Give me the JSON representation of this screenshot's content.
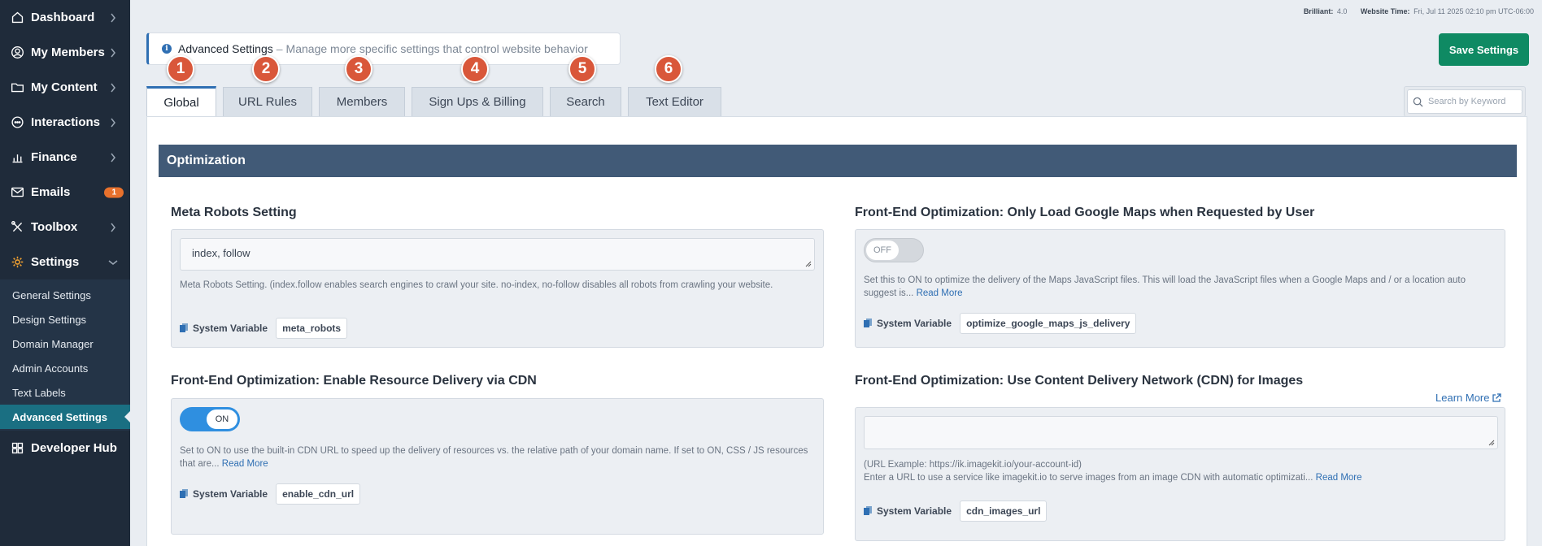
{
  "sidebar": {
    "items": [
      {
        "label": "Dashboard",
        "icon": "home-icon"
      },
      {
        "label": "My Members",
        "icon": "user-circle-icon"
      },
      {
        "label": "My Content",
        "icon": "folder-icon"
      },
      {
        "label": "Interactions",
        "icon": "chat-icon"
      },
      {
        "label": "Finance",
        "icon": "bar-chart-icon"
      },
      {
        "label": "Emails",
        "icon": "mail-icon",
        "badge": "1"
      },
      {
        "label": "Toolbox",
        "icon": "tools-icon"
      },
      {
        "label": "Settings",
        "icon": "gear-icon"
      }
    ],
    "sub_items": [
      "General Settings",
      "Design Settings",
      "Domain Manager",
      "Admin Accounts",
      "Text Labels",
      "Advanced Settings"
    ],
    "developer_hub": "Developer Hub",
    "colors": {
      "background": "#1f2b3a",
      "active": "#1a6f82",
      "badge": "#e8712c"
    }
  },
  "top_info": {
    "brilliant_label": "Brilliant:",
    "brilliant_value": "4.0",
    "time_label": "Website Time:",
    "time_value": "Fri, Jul 11 2025 02:10 pm UTC-06:00"
  },
  "header": {
    "title": "Advanced Settings",
    "separator": "–",
    "description": "Manage more specific settings that control website behavior",
    "save_label": "Save Settings"
  },
  "tabs": [
    {
      "number": "1",
      "label": "Global"
    },
    {
      "number": "2",
      "label": "URL Rules"
    },
    {
      "number": "3",
      "label": "Members"
    },
    {
      "number": "4",
      "label": "Sign Ups & Billing"
    },
    {
      "number": "5",
      "label": "Search"
    },
    {
      "number": "6",
      "label": "Text Editor"
    }
  ],
  "search": {
    "placeholder": "Search by Keyword"
  },
  "section": {
    "title": "Optimization"
  },
  "settings": {
    "meta_robots": {
      "title": "Meta Robots Setting",
      "value": "index, follow",
      "help": "Meta Robots Setting. (index.follow enables search engines to crawl your site. no-index, no-follow disables all robots from crawling your website.",
      "sys_label": "System Variable",
      "sys_var": "meta_robots"
    },
    "google_maps": {
      "title": "Front-End Optimization: Only Load Google Maps when Requested by User",
      "toggle": "OFF",
      "help": "Set this to ON to optimize the delivery of the Maps JavaScript files. This will load the JavaScript files when a Google Maps and / or a location auto suggest is...",
      "read_more": "Read More",
      "sys_label": "System Variable",
      "sys_var": "optimize_google_maps_js_delivery"
    },
    "cdn_url": {
      "title": "Front-End Optimization: Enable Resource Delivery via CDN",
      "toggle": "ON",
      "help": "Set to ON to use the built-in CDN URL to speed up the delivery of resources vs. the relative path of your domain name. If set to ON, CSS / JS resources that are...",
      "read_more": "Read More",
      "sys_label": "System Variable",
      "sys_var": "enable_cdn_url"
    },
    "cdn_images": {
      "title": "Front-End Optimization: Use Content Delivery Network (CDN) for Images",
      "learn_more": "Learn More",
      "value": "",
      "example": "(URL Example: https://ik.imagekit.io/your-account-id)",
      "help": "Enter a URL to use a service like imagekit.io to serve images from an image CDN with automatic optimizati...",
      "read_more": "Read More",
      "sys_label": "System Variable",
      "sys_var": "cdn_images_url"
    }
  },
  "colors": {
    "accent": "#2f6fb3",
    "save": "#0f8a63",
    "section_bar": "#415a77",
    "step_badge": "#d9573a",
    "toggle_on": "#2f8fe0"
  }
}
